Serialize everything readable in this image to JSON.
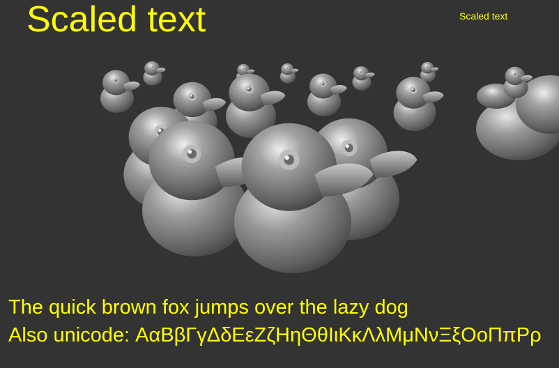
{
  "window": {
    "background": "#333333",
    "text_color": "#ffff00"
  },
  "overlay": {
    "scaled_text_large": "Scaled text",
    "scaled_text_small": "Scaled text",
    "sample_line": "The quick brown fox jumps over the lazy dog",
    "unicode_line": "Also unicode: ΑαΒβΓγΔδΕεΖζΗηΘθΙιΚκΛλΜμΝνΞξΟοΠπΡρ"
  },
  "scene": {
    "object": "rubber-duck-icon",
    "material_color": "#8c8c8c"
  }
}
